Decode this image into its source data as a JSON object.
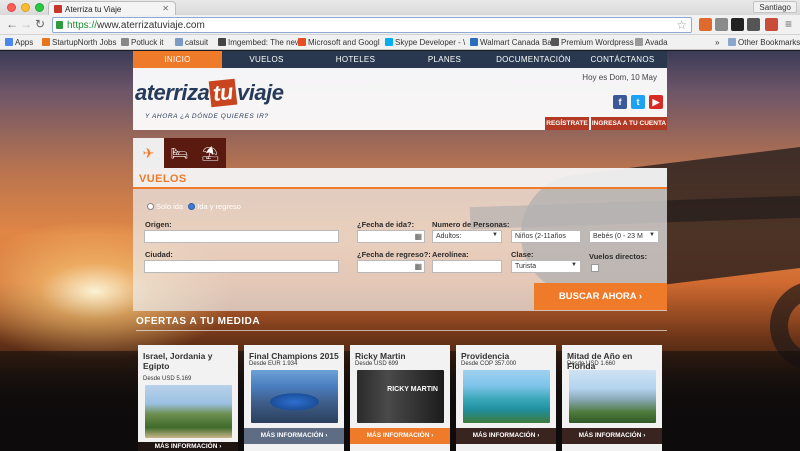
{
  "browser": {
    "tab_title": "Aterriza tu Viaje",
    "tab_close": "✕",
    "profile": "Santiago",
    "url_scheme": "https://",
    "url_rest": "www.aterrizatuviaje.com",
    "back": "←",
    "forward": "→",
    "reload": "↻",
    "star": "☆",
    "menu": "≡",
    "bookmarks": [
      {
        "label": "Apps",
        "color": "#4a87ee"
      },
      {
        "label": "StartupNorth Jobs",
        "color": "#e8751a"
      },
      {
        "label": "Potluck it",
        "color": "#888888"
      },
      {
        "label": "catsuit",
        "color": "#7a9bc4"
      },
      {
        "label": "Imgembed: The new",
        "color": "#444444"
      },
      {
        "label": "Microsoft and Googl",
        "color": "#e44d26"
      },
      {
        "label": "Skype Developer - \\",
        "color": "#00aff0"
      },
      {
        "label": "Walmart Canada Ba",
        "color": "#2a6ebb"
      },
      {
        "label": "Premium Wordpress",
        "color": "#555555"
      },
      {
        "label": "Avada",
        "color": "#9a9a9a"
      }
    ],
    "bookmarks_more": "»",
    "other_bookmarks": "Other Bookmarks"
  },
  "nav": {
    "items": [
      "INICIO",
      "VUELOS",
      "HOTELES",
      "PLANES",
      "DOCUMENTACIÓN",
      "CONTÁCTANOS"
    ],
    "active_index": 0
  },
  "header": {
    "logo_left": "aterriza",
    "logo_tu": "tu",
    "logo_right": "viaje",
    "tagline": "Y AHORA ¿A DÓNDE QUIERES IR?",
    "date": "Hoy es Dom, 10 May",
    "social": {
      "facebook": "f",
      "twitter": "t",
      "youtube": "▶"
    },
    "register": "REGÍSTRATE",
    "login": "INGRESA A TU CUENTA"
  },
  "service_tabs": [
    {
      "icon": "✈",
      "name": "flights"
    },
    {
      "icon": "🛏",
      "name": "hotels"
    },
    {
      "icon": "⛱",
      "name": "vacations"
    }
  ],
  "search": {
    "title": "VUELOS",
    "trip_oneway": "Solo ida",
    "trip_round": "Ida y regreso",
    "origin_label": "Origen:",
    "city_label": "Ciudad:",
    "depart_label": "¿Fecha de ida?:",
    "return_label": "¿Fecha de regreso?:",
    "people_label": "Numero de Personas:",
    "airline_label": "Aerolínea:",
    "class_label": "Clase:",
    "adults_value": "Adultos:",
    "children_value": "Niños (2-11años",
    "babies_value": "Bebés (0 - 23 M",
    "class_value": "Turista",
    "direct_label": "Vuelos directos:",
    "calendar_icon": "▦",
    "dropdown_icon": "▼",
    "submit": "BUSCAR AHORA ›"
  },
  "offers": {
    "title": "OFERTAS A TU MEDIDA",
    "more_label": "MÁS INFORMACIÓN ›",
    "cards": [
      {
        "title": "Israel, Jordania y Egipto",
        "price": "Desde USD 5.169"
      },
      {
        "title": "Final Champions 2015",
        "price": "Desde EUR 1.934"
      },
      {
        "title": "Ricky Martin",
        "price": "Desde USD 699",
        "img_text": "RICKY MARTIN"
      },
      {
        "title": "Providencia",
        "price": "Desde COP 357.000"
      },
      {
        "title": "Mitad de Año en Florida",
        "price": "Desde USD 1.660"
      }
    ]
  },
  "colors": {
    "accent": "#ee7a2a",
    "nav": "#29384f",
    "account": "#b23a24"
  }
}
